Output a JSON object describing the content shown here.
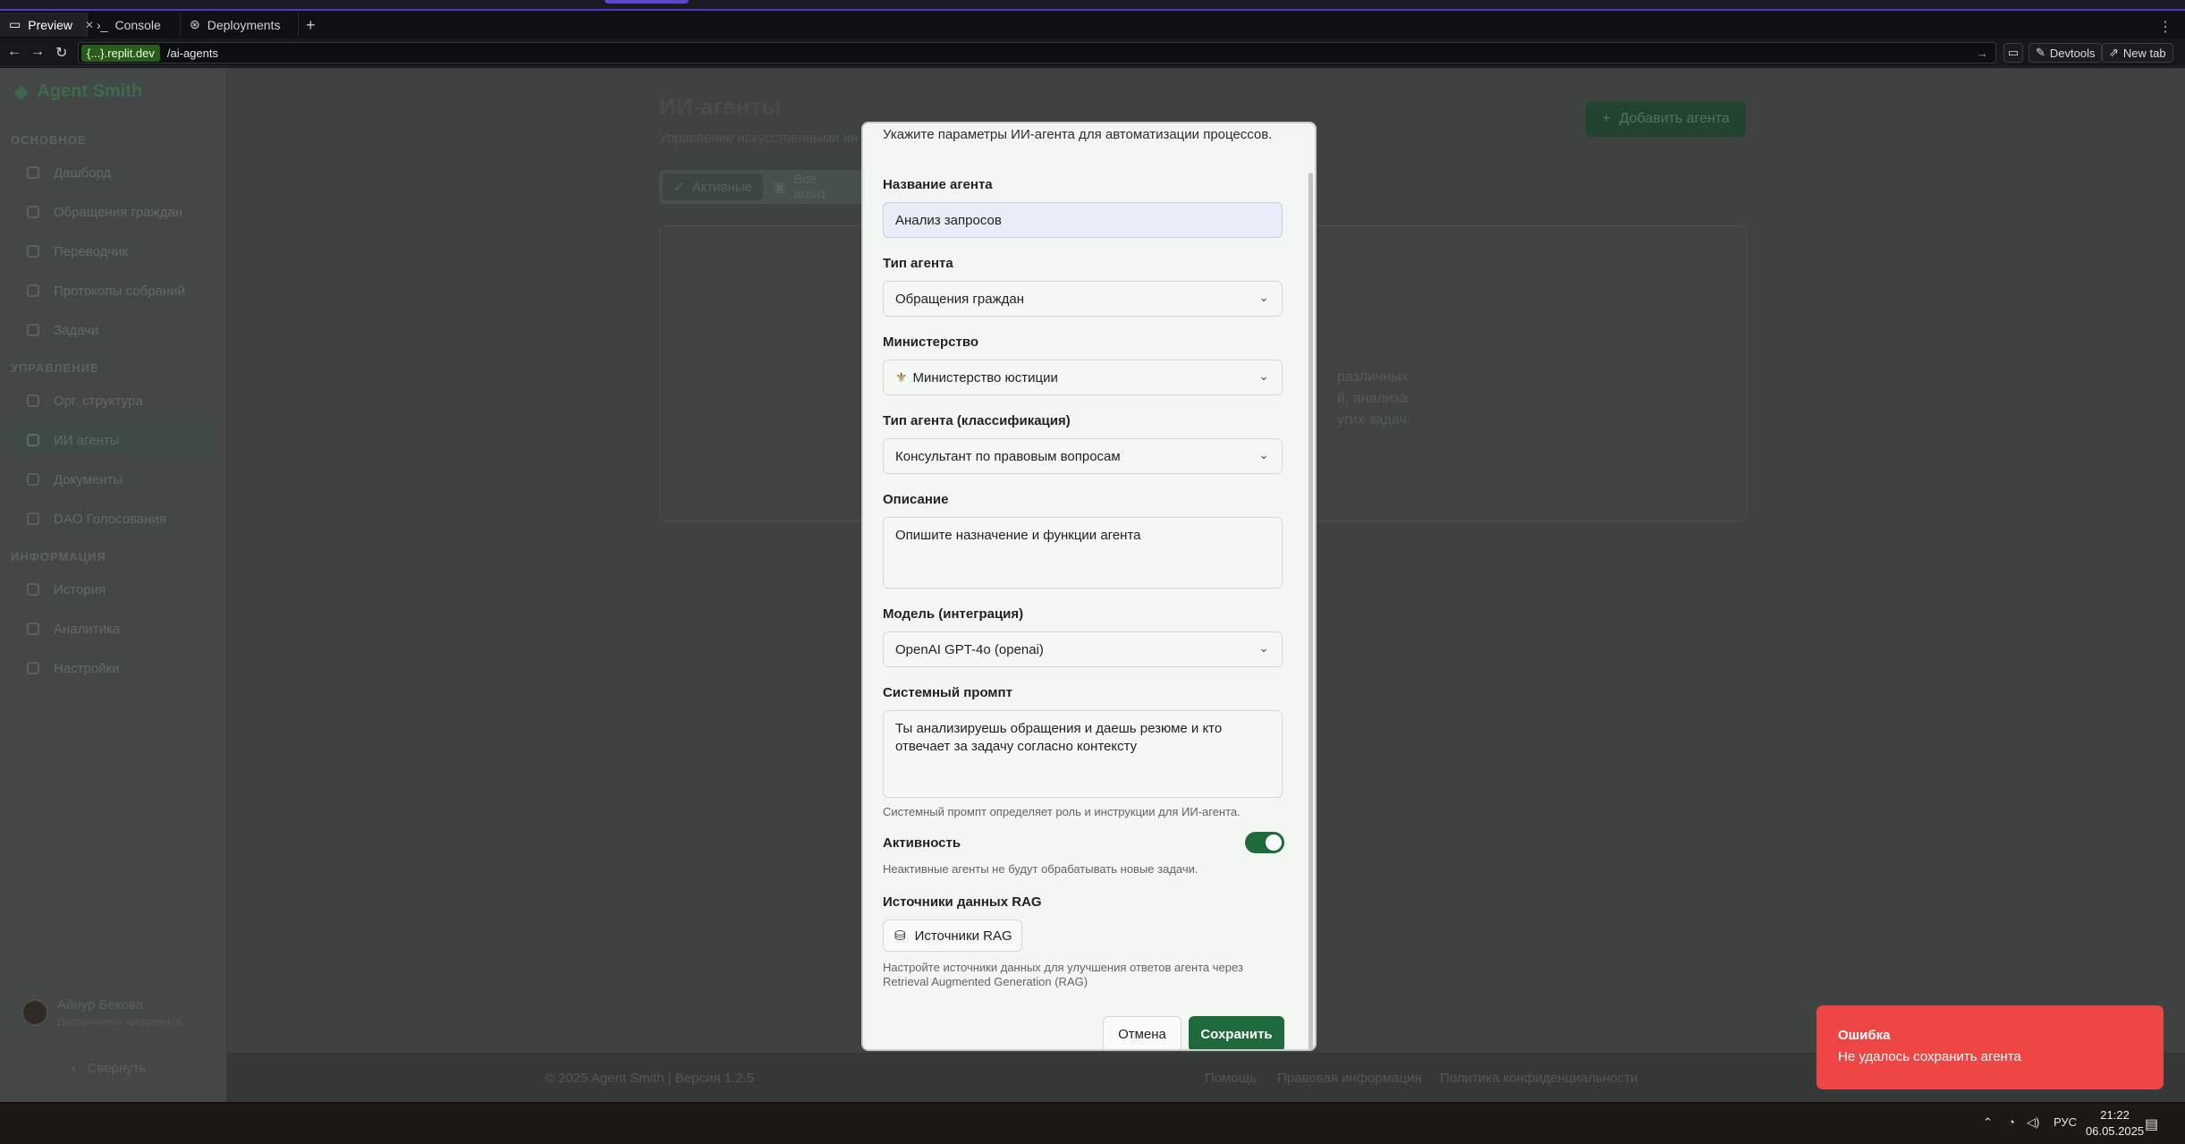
{
  "browser": {
    "tabs": [
      {
        "label": "Preview",
        "icon": "monitor-icon"
      },
      {
        "label": "Console",
        "icon": "terminal-icon"
      },
      {
        "label": "Deployments",
        "icon": "deploy-icon"
      }
    ],
    "url_host": "{...}.replit.dev",
    "url_path": "/ai-agents",
    "devtools_label": "Devtools",
    "newtab_label": "New tab"
  },
  "sidebar": {
    "brand": "Agent Smith",
    "sections": [
      {
        "title": "ОСНОВНОЕ",
        "items": [
          "Дашборд",
          "Обращения граждан",
          "Переводчик",
          "Протоколы собраний",
          "Задачи"
        ]
      },
      {
        "title": "УПРАВЛЕНИЕ",
        "items": [
          "Орг. структура",
          "ИИ агенты",
          "Документы",
          "DAO Голосования"
        ]
      },
      {
        "title": "ИНФОРМАЦИЯ",
        "items": [
          "История",
          "Аналитика",
          "Настройки"
        ]
      }
    ],
    "active_item": "ИИ агенты",
    "user_name": "Айнур Бекова",
    "user_dept": "Департамент цифровиза...",
    "collapse_label": "Свернуть"
  },
  "main": {
    "title": "ИИ-агенты",
    "subtitle": "Управление искусственными ин",
    "add_button": "Добавить агента",
    "tab_active": "Активные",
    "tab_all": "Все агент",
    "card_text": [
      "различных",
      "й, анализа",
      "угих задач."
    ]
  },
  "footer": {
    "copyright": "© 2025 Agent Smith | Версия 1.2.5",
    "links": [
      "Помощь",
      "Правовая информация",
      "Политика конфиденциальности"
    ]
  },
  "modal": {
    "description": "Укажите параметры ИИ-агента для автоматизации процессов.",
    "name_label": "Название агента",
    "name_value": "Анализ запросов",
    "type_label": "Тип агента",
    "type_value": "Обращения граждан",
    "ministry_label": "Министерство",
    "ministry_value": "Министерство юстиции",
    "class_label": "Тип агента (классификация)",
    "class_value": "Консультант по правовым вопросам",
    "desc_label": "Описание",
    "desc_placeholder": "Опишите назначение и функции агента",
    "model_label": "Модель (интеграция)",
    "model_value": "OpenAI GPT-4o (openai)",
    "prompt_label": "Системный промпт",
    "prompt_value": "Ты анализируешь обращения и даешь резюме и кто отвечает за задачу согласно контексту",
    "prompt_hint": "Системный промпт определяет роль и инструкции для ИИ-агента.",
    "active_label": "Активность",
    "active_value": true,
    "active_hint": "Неактивные агенты не будут обрабатывать новые задачи.",
    "rag_label": "Источники данных RAG",
    "rag_button": "Источники RAG",
    "rag_hint": "Настройте источники данных для улучшения ответов агента через Retrieval Augmented Generation (RAG)",
    "cancel": "Отмена",
    "save": "Сохранить"
  },
  "toast": {
    "title": "Ошибка",
    "message": "Не удалось сохранить агента",
    "color": "#ee4645"
  },
  "taskbar": {
    "lang": "РУС",
    "time": "21:22",
    "date": "06.05.2025"
  },
  "colors": {
    "accent": "#1f6a3c",
    "error": "#ee4645"
  }
}
